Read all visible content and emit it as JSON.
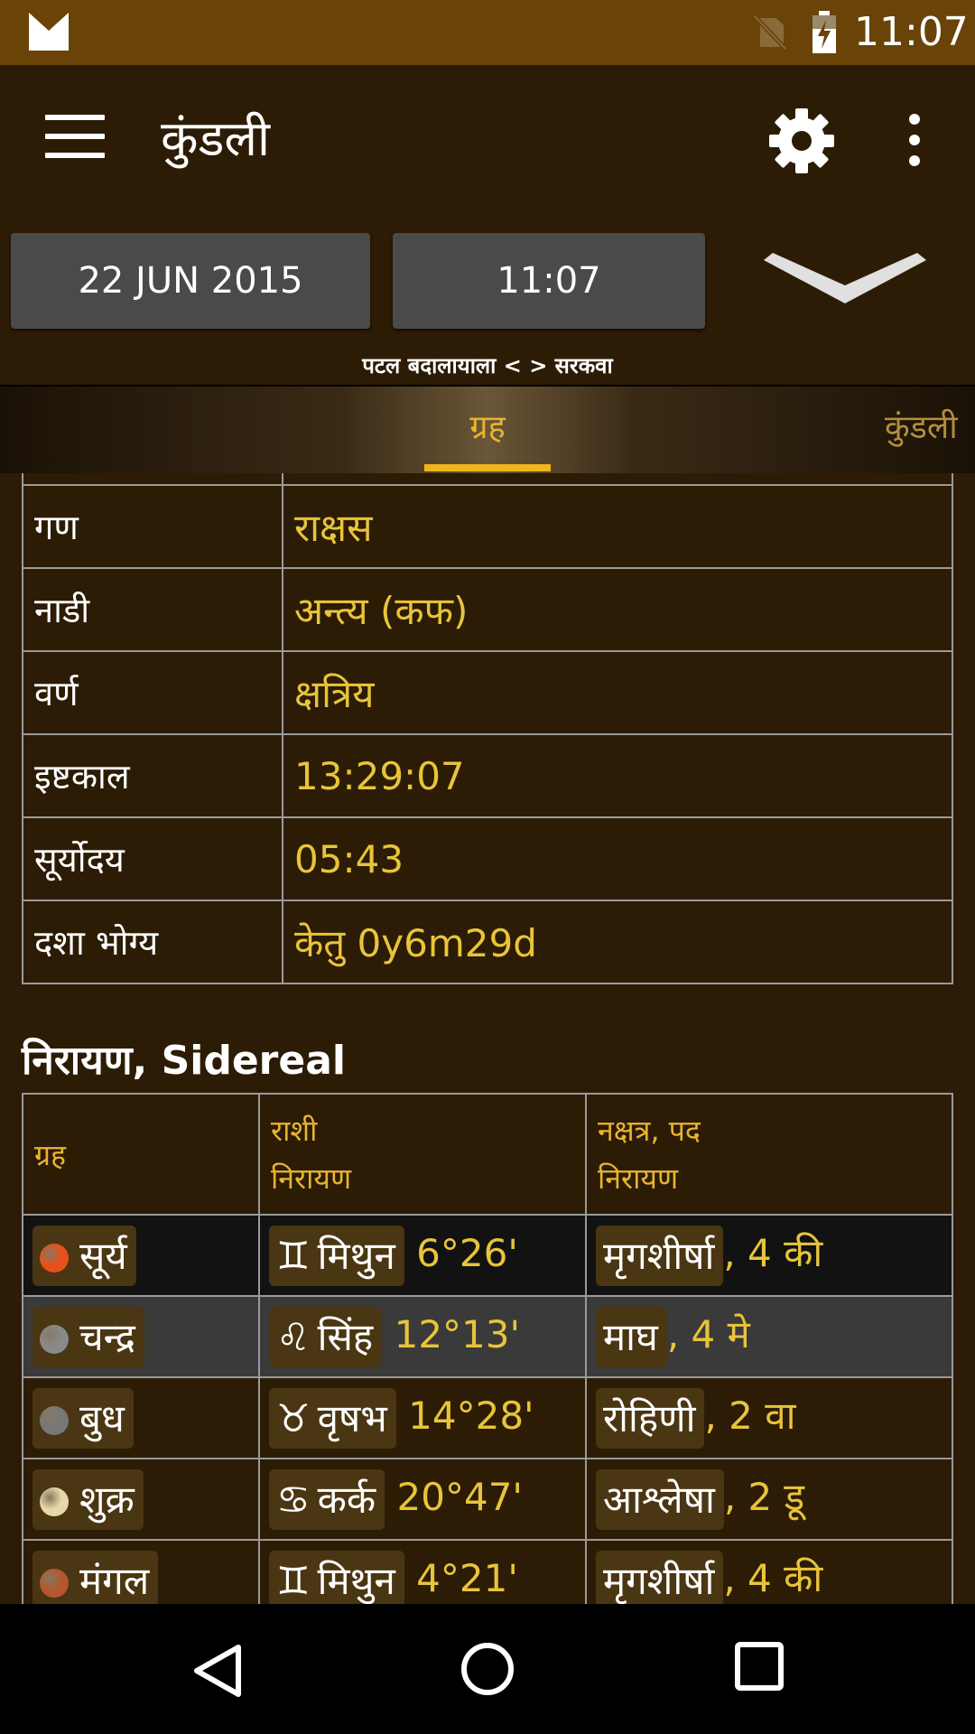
{
  "status_bar": {
    "time": "11:07"
  },
  "app_bar": {
    "title": "कुंडली"
  },
  "controls": {
    "date": "22 JUN 2015",
    "time": "11:07",
    "hint": "पटल बदालायाला < > सरकवा"
  },
  "tabs": {
    "active": "ग्रह",
    "next": "कुंडली"
  },
  "info_rows": [
    {
      "label": "गण",
      "value": "राक्षस"
    },
    {
      "label": "नाडी",
      "value": "अन्त्य (कफ)"
    },
    {
      "label": "वर्ण",
      "value": "क्षत्रिय"
    },
    {
      "label": "इष्टकाल",
      "value": "13:29:07"
    },
    {
      "label": "सूर्योदय",
      "value": "05:43"
    },
    {
      "label": "दशा भोग्य",
      "value": "केतु 0y6m29d"
    }
  ],
  "sidereal": {
    "title": "निरायण, Sidereal",
    "headers": {
      "planet": "ग्रह",
      "rashi": "राशी",
      "rashi_sub": "निरायण",
      "nakshatra": "नक्षत्र, पद",
      "nakshatra_sub": "निरायण"
    },
    "rows": [
      {
        "planet": "सूर्य",
        "dot_color": "#e8501a",
        "zodiac": "♊",
        "rashi": "मिथुन",
        "degree": "6°26'",
        "nakshatra": "मृगशीर्षा",
        "pada": ", 4 की"
      },
      {
        "planet": "चन्द्र",
        "dot_color": "#8a8a8a",
        "zodiac": "♌",
        "rashi": "सिंह",
        "degree": "12°13'",
        "nakshatra": "माघ",
        "pada": ", 4 मे"
      },
      {
        "planet": "बुध",
        "dot_color": "#777777",
        "zodiac": "♉",
        "rashi": "वृषभ",
        "degree": "14°28'",
        "nakshatra": "रोहिणी",
        "pada": ", 2 वा"
      },
      {
        "planet": "शुक्र",
        "dot_color": "#e8d7a8",
        "zodiac": "♋",
        "rashi": "कर्क",
        "degree": "20°47'",
        "nakshatra": "आश्लेषा",
        "pada": ", 2 डू"
      },
      {
        "planet": "मंगल",
        "dot_color": "#b5562e",
        "zodiac": "♊",
        "rashi": "मिथुन",
        "degree": "4°21'",
        "nakshatra": "मृगशीर्षा",
        "pada": ", 4 की"
      }
    ]
  },
  "icons": {
    "status": [
      "gmail-icon",
      "no-sim-icon",
      "battery-charging-icon"
    ],
    "app_bar": [
      "menu-icon",
      "gear-icon",
      "more-vert-icon"
    ],
    "nav": [
      "back-icon",
      "home-icon",
      "recents-icon"
    ]
  }
}
